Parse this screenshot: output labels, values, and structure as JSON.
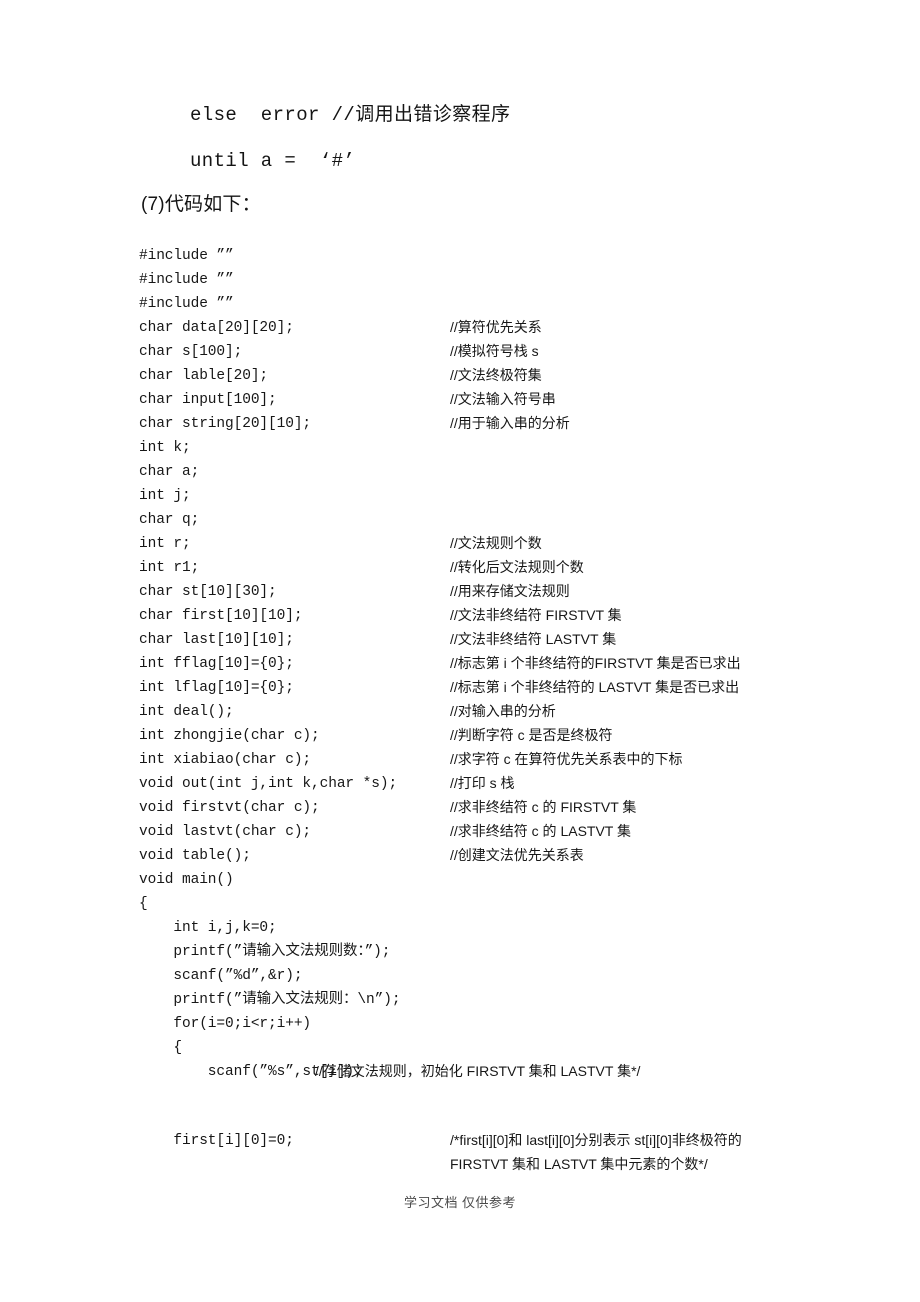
{
  "document": {
    "pseudocode_lines": [
      "else  error //调用出错诊察程序",
      "until a =  ‘#’"
    ],
    "section_heading": "(7)代码如下：",
    "code_lines": [
      {
        "code": "#include ””",
        "comment": ""
      },
      {
        "code": "#include ””",
        "comment": ""
      },
      {
        "code": "#include ””",
        "comment": ""
      },
      {
        "code": "char data[20][20];",
        "comment": "//算符优先关系"
      },
      {
        "code": "char s[100];",
        "comment": "//模拟符号栈 s"
      },
      {
        "code": "char lable[20];",
        "comment": "//文法终极符集"
      },
      {
        "code": "char input[100];",
        "comment": "//文法输入符号串"
      },
      {
        "code": "char string[20][10];",
        "comment": "//用于输入串的分析"
      },
      {
        "code": "int k;",
        "comment": ""
      },
      {
        "code": "char a;",
        "comment": ""
      },
      {
        "code": "int j;",
        "comment": ""
      },
      {
        "code": "char q;",
        "comment": ""
      },
      {
        "code": "int r;",
        "comment": "//文法规则个数"
      },
      {
        "code": "int r1;",
        "comment": "//转化后文法规则个数"
      },
      {
        "code": "char st[10][30];",
        "comment": "//用来存储文法规则"
      },
      {
        "code": "char first[10][10];",
        "comment": "//文法非终结符 FIRSTVT 集"
      },
      {
        "code": "char last[10][10];",
        "comment": "//文法非终结符 LASTVT 集"
      },
      {
        "code": "int fflag[10]={0};",
        "comment": "//标志第 i 个非终结符的FIRSTVT 集是否已求出"
      },
      {
        "code": "int lflag[10]={0};",
        "comment": "//标志第 i 个非终结符的 LASTVT 集是否已求出"
      },
      {
        "code": "int deal();",
        "comment": "//对输入串的分析"
      },
      {
        "code": "int zhongjie(char c);",
        "comment": "//判断字符 c 是否是终极符"
      },
      {
        "code": "int xiabiao(char c);",
        "comment": "//求字符 c 在算符优先关系表中的下标"
      },
      {
        "code": "void out(int j,int k,char *s);",
        "comment": "//打印 s 栈"
      },
      {
        "code": "void firstvt(char c);",
        "comment": "//求非终结符 c 的 FIRSTVT 集"
      },
      {
        "code": "void lastvt(char c);",
        "comment": "//求非终结符 c 的 LASTVT 集"
      },
      {
        "code": "void table();",
        "comment": "//创建文法优先关系表"
      },
      {
        "code": "void main()",
        "comment": ""
      },
      {
        "code": "{",
        "comment": ""
      },
      {
        "code": "    int i,j,k=0;",
        "comment": ""
      },
      {
        "code": "    printf(”请输入文法规则数：”);",
        "comment": ""
      },
      {
        "code": "    scanf(”%d”,&r);",
        "comment": ""
      },
      {
        "code": "    printf(”请输入文法规则：\\n”);",
        "comment": ""
      },
      {
        "code": "    for(i=0;i<r;i++)",
        "comment": ""
      },
      {
        "code": "    {",
        "comment": ""
      }
    ],
    "scanf_line": {
      "code": "        scanf(”%s”,st[i]);",
      "comment": "//存储文法规则，初始化 FIRSTVT 集和 LASTVT 集*/"
    },
    "first_line": {
      "code": "    first[i][0]=0;",
      "comment": "/*first[i][0]和 last[i][0]分别表示 st[i][0]非终极符的 FIRSTVT 集和 LASTVT 集中元素的个数*/"
    },
    "footer_text": "学习文档 仅供参考"
  }
}
